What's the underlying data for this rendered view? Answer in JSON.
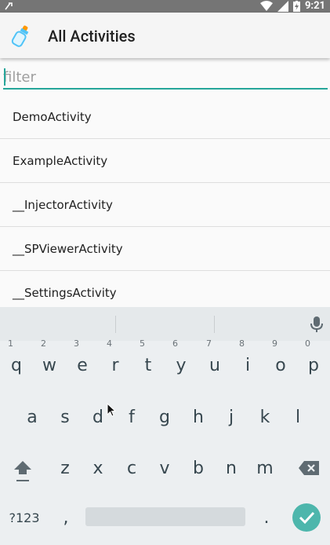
{
  "status": {
    "time": "9:21"
  },
  "appbar": {
    "title": "All Activities",
    "logo_icon": "baby-bottle-icon"
  },
  "filter": {
    "placeholder": "filter",
    "value": ""
  },
  "activities": [
    "DemoActivity",
    "ExampleActivity",
    "__InjectorActivity",
    "__SPViewerActivity",
    "__SettingsActivity"
  ],
  "keyboard": {
    "row1": [
      {
        "k": "q",
        "h": "1"
      },
      {
        "k": "w",
        "h": "2"
      },
      {
        "k": "e",
        "h": "3"
      },
      {
        "k": "r",
        "h": "4"
      },
      {
        "k": "t",
        "h": "5"
      },
      {
        "k": "y",
        "h": "6"
      },
      {
        "k": "u",
        "h": "7"
      },
      {
        "k": "i",
        "h": "8"
      },
      {
        "k": "o",
        "h": "9"
      },
      {
        "k": "p",
        "h": "0"
      }
    ],
    "row2": [
      "a",
      "s",
      "d",
      "f",
      "g",
      "h",
      "j",
      "k",
      "l"
    ],
    "row3": [
      "z",
      "x",
      "c",
      "v",
      "b",
      "n",
      "m"
    ],
    "symbols_label": "?123",
    "comma": ",",
    "period": "."
  },
  "colors": {
    "accent": "#26a69a",
    "enter": "#4db6ac"
  }
}
